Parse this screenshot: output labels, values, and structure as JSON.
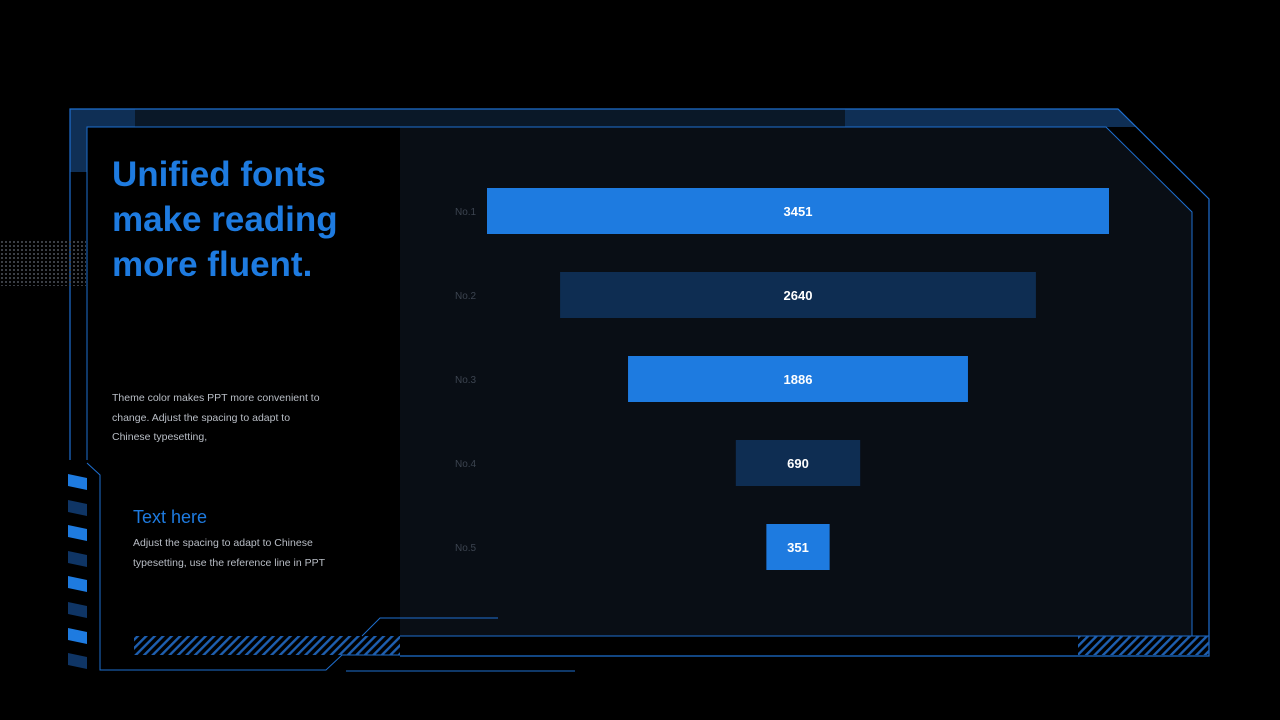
{
  "left_panel": {
    "headline": "Unified fonts make reading more fluent.",
    "description": "Theme color makes PPT more convenient to change. Adjust the spacing to adapt to Chinese typesetting,",
    "sub_title": "Text here",
    "sub_description": "Adjust the spacing to adapt to Chinese typesetting, use the reference line in PPT"
  },
  "colors": {
    "accent": "#1e7be0",
    "dark_bar": "#0e2d52",
    "panel": "#0a0f16",
    "background": "#000000"
  },
  "chart_data": {
    "type": "bar",
    "orientation": "horizontal-funnel",
    "categories": [
      "No.1",
      "No.2",
      "No.3",
      "No.4",
      "No.5"
    ],
    "values": [
      3451,
      2640,
      1886,
      690,
      351
    ],
    "data_labels": [
      "3451",
      "2640",
      "1886",
      "690",
      "351"
    ],
    "bar_colors": [
      "#1e7be0",
      "#0e2d52",
      "#1e7be0",
      "#0e2d52",
      "#1e7be0"
    ],
    "title": "",
    "xlabel": "",
    "ylabel": "",
    "xlim": [
      0,
      3451
    ]
  }
}
